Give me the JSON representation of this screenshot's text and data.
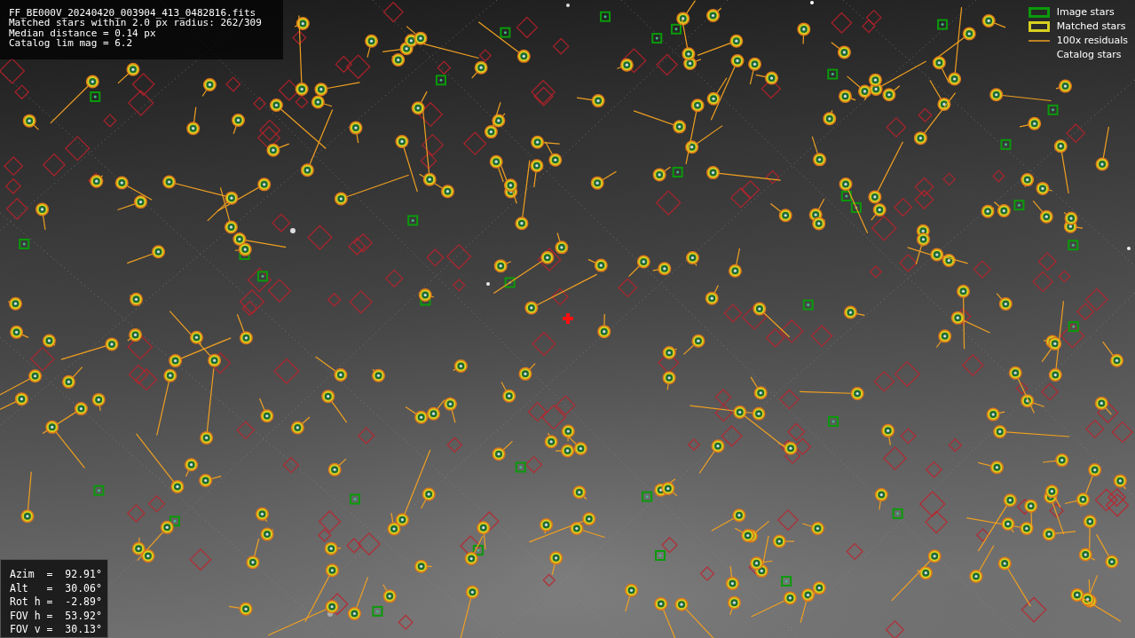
{
  "image_info": [
    "FF_BE000V_20240420_003904_413_0482816.fits",
    "Matched stars within 2.0 px radius: 262/309",
    "Median distance = 0.14 px",
    "Catalog lim mag = 6.2"
  ],
  "legend": [
    {
      "label": "Image stars"
    },
    {
      "label": "Matched stars",
      "kind": "matched"
    },
    {
      "label": "100x residuals",
      "kind": "residual"
    },
    {
      "label": "Catalog stars",
      "kind": "catalog"
    }
  ],
  "pointing": [
    "Azim  =  92.91°",
    "Alt   =  30.06°",
    "Rot h =  -2.89°",
    "FOV h =  53.92°",
    "FOV v =  30.13°"
  ]
}
